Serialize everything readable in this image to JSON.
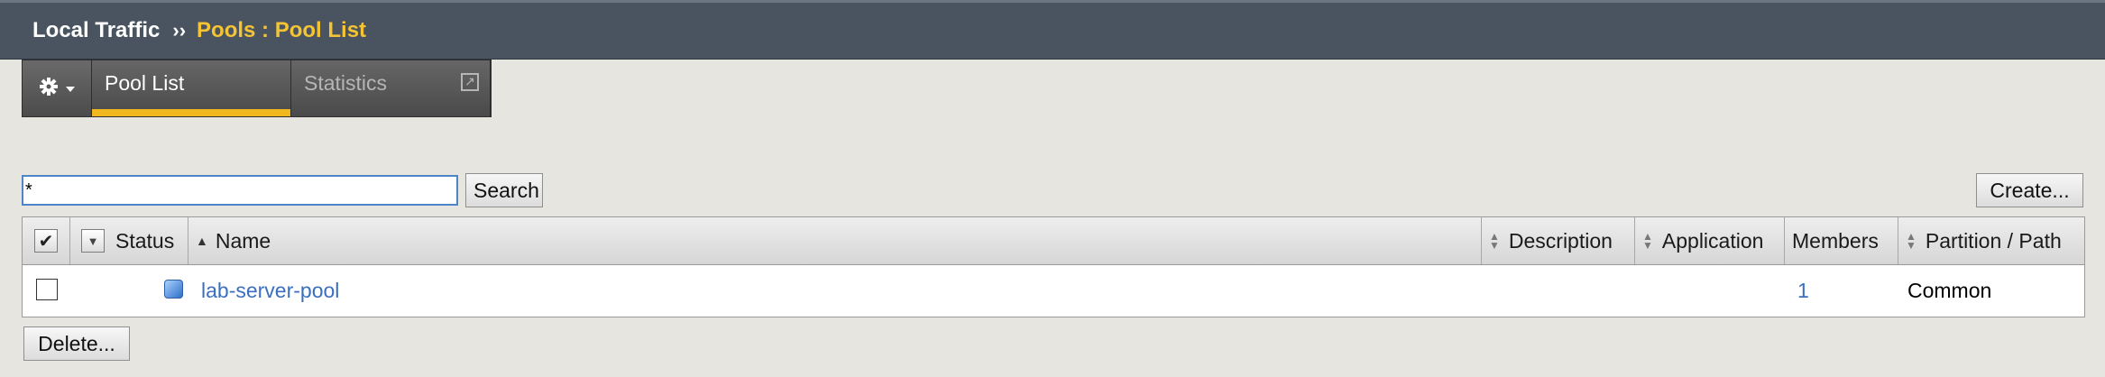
{
  "breadcrumb": {
    "root": "Local Traffic",
    "separator": "››",
    "current": "Pools : Pool List"
  },
  "tabs": {
    "gear_icon": "gear-icon",
    "items": [
      {
        "label": "Pool List",
        "active": true
      },
      {
        "label": "Statistics",
        "active": false
      }
    ]
  },
  "search": {
    "value": "*",
    "button_label": "Search"
  },
  "actions": {
    "create_label": "Create...",
    "delete_label": "Delete..."
  },
  "table": {
    "headers": {
      "status": "Status",
      "name": "Name",
      "description": "Description",
      "application": "Application",
      "members": "Members",
      "partition": "Partition / Path"
    },
    "rows": [
      {
        "checked": false,
        "status_icon": "available-status-icon",
        "name": "lab-server-pool",
        "description": "",
        "application": "",
        "members": "1",
        "partition": "Common"
      }
    ]
  },
  "colors": {
    "accent": "#f0b81e",
    "topbar": "#4a5461",
    "link": "#3b6fbf"
  }
}
